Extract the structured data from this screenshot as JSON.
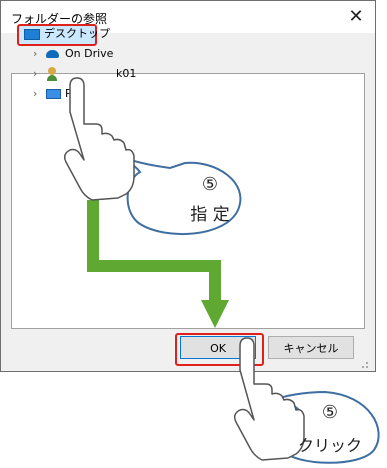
{
  "dialog": {
    "title": "フォルダーの参照",
    "close_glyph": "✕",
    "tree": [
      {
        "label": "デスクトップ",
        "icon": "desktop-icon",
        "selected": true
      },
      {
        "label": "OneDrive",
        "icon": "cloud-icon",
        "visible_text": "On   Drive"
      },
      {
        "label": "k01",
        "icon": "user-icon",
        "visible_text": "k01"
      },
      {
        "label": "P",
        "icon": "pc-icon",
        "visible_text": "P"
      }
    ],
    "ok_label": "OK",
    "cancel_label": "キャンセル"
  },
  "callouts": [
    {
      "number": "⑤",
      "text": "指 定"
    },
    {
      "number": "⑤",
      "text": "クリック"
    }
  ],
  "colors": {
    "highlight_red": "#e0201b",
    "arrow_green": "#5fa831",
    "callout_border": "#3f6ea3"
  }
}
